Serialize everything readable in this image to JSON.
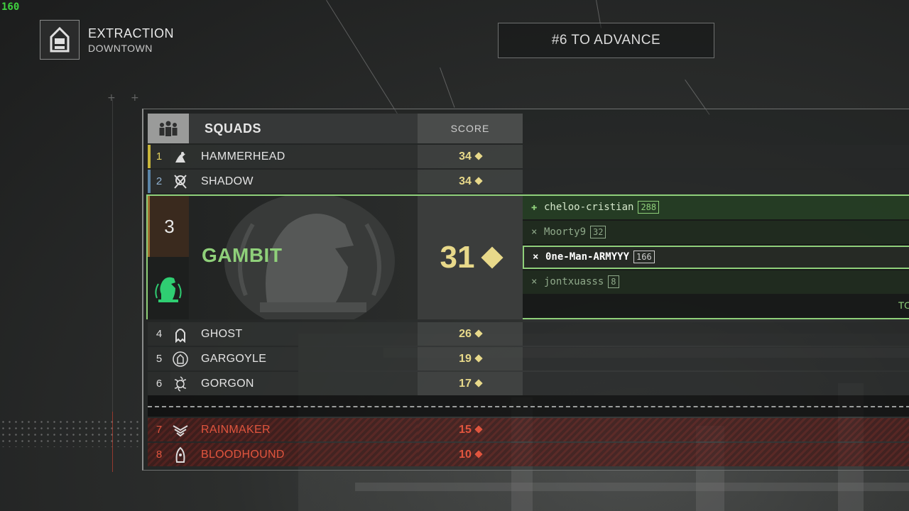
{
  "fps": "160",
  "mode": {
    "title": "EXTRACTION",
    "subtitle": "DOWNTOWN"
  },
  "advance_text": "#6 TO ADVANCE",
  "header": {
    "squads_label": "SQUADS",
    "score_label": "SCORE"
  },
  "squads_top": [
    {
      "rank": "1",
      "name": "HAMMERHEAD",
      "score": "34",
      "icon": "hammerhead-icon",
      "strip_color": "#c9b63a"
    },
    {
      "rank": "2",
      "name": "SHADOW",
      "score": "34",
      "icon": "shadow-icon",
      "strip_color": "#5b85a8"
    }
  ],
  "selected_squad": {
    "rank": "3",
    "name": "GAMBIT",
    "score": "31",
    "icon": "knight-icon",
    "accent": "#8fd07a",
    "members": [
      {
        "marker": "✚",
        "name": "cheloo-cristian",
        "points": "288",
        "status": "alive"
      },
      {
        "marker": "×",
        "name": "Moorty9",
        "points": "32",
        "status": "eliminated"
      },
      {
        "marker": "×",
        "name": "0ne-Man-ARMYYY",
        "points": "166",
        "status": "highlighted"
      },
      {
        "marker": "×",
        "name": "jontxuasss",
        "points": "8",
        "status": "eliminated"
      }
    ],
    "footer_text": "TO"
  },
  "squads_mid": [
    {
      "rank": "4",
      "name": "GHOST",
      "score": "26",
      "icon": "ghost-icon"
    },
    {
      "rank": "5",
      "name": "GARGOYLE",
      "score": "19",
      "icon": "gargoyle-icon"
    },
    {
      "rank": "6",
      "name": "GORGON",
      "score": "17",
      "icon": "gorgon-icon"
    }
  ],
  "squads_eliminated": [
    {
      "rank": "7",
      "name": "RAINMAKER",
      "score": "15",
      "icon": "rainmaker-icon"
    },
    {
      "rank": "8",
      "name": "BLOODHOUND",
      "score": "10",
      "icon": "bloodhound-icon"
    }
  ],
  "colors": {
    "gold": "#e8d98a",
    "green": "#8fd07a",
    "red": "#e0553e"
  }
}
